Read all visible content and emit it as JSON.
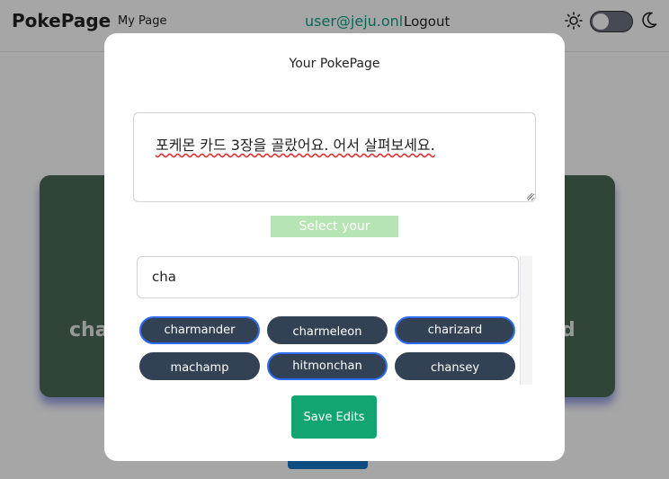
{
  "navbar": {
    "brand": "PokePage",
    "my_page": "My Page",
    "user_email": "user@jeju.onl",
    "logout": "Logout",
    "theme_toggle": {
      "state": "light",
      "icons": [
        "sun-icon",
        "moon-icon"
      ]
    }
  },
  "background": {
    "card_left_text": "char",
    "card_right_text": "d"
  },
  "modal": {
    "title": "Your PokePage",
    "message": "포케몬 카드 3장을 골랐어요. 어서 살펴보세요.",
    "select_label": "Select your pokemon",
    "search_value": "cha",
    "pokemon": [
      {
        "name": "charmander",
        "selected": true
      },
      {
        "name": "charmeleon",
        "selected": false
      },
      {
        "name": "charizard",
        "selected": true
      },
      {
        "name": "machamp",
        "selected": false
      },
      {
        "name": "hitmonchan",
        "selected": true
      },
      {
        "name": "chansey",
        "selected": false
      }
    ],
    "save_label": "Save Edits"
  },
  "colors": {
    "accent_email": "#0f9f8a",
    "chip_bg": "#334155",
    "chip_selected_border": "#2f6bf0",
    "save_bg": "#12a572",
    "label_bg": "#b7e4b3"
  }
}
